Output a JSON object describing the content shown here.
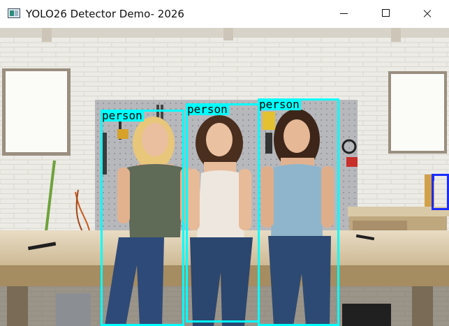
{
  "window": {
    "title": "YOLO26 Detector Demo- 2026",
    "controls": {
      "minimize": "minimize",
      "maximize": "maximize",
      "close": "close"
    }
  },
  "colors": {
    "person_box": "#00ffff",
    "other_box": "#1a2cff"
  },
  "detections": [
    {
      "label": "person"
    },
    {
      "label": "person"
    },
    {
      "label": "person"
    },
    {
      "label": ""
    }
  ]
}
